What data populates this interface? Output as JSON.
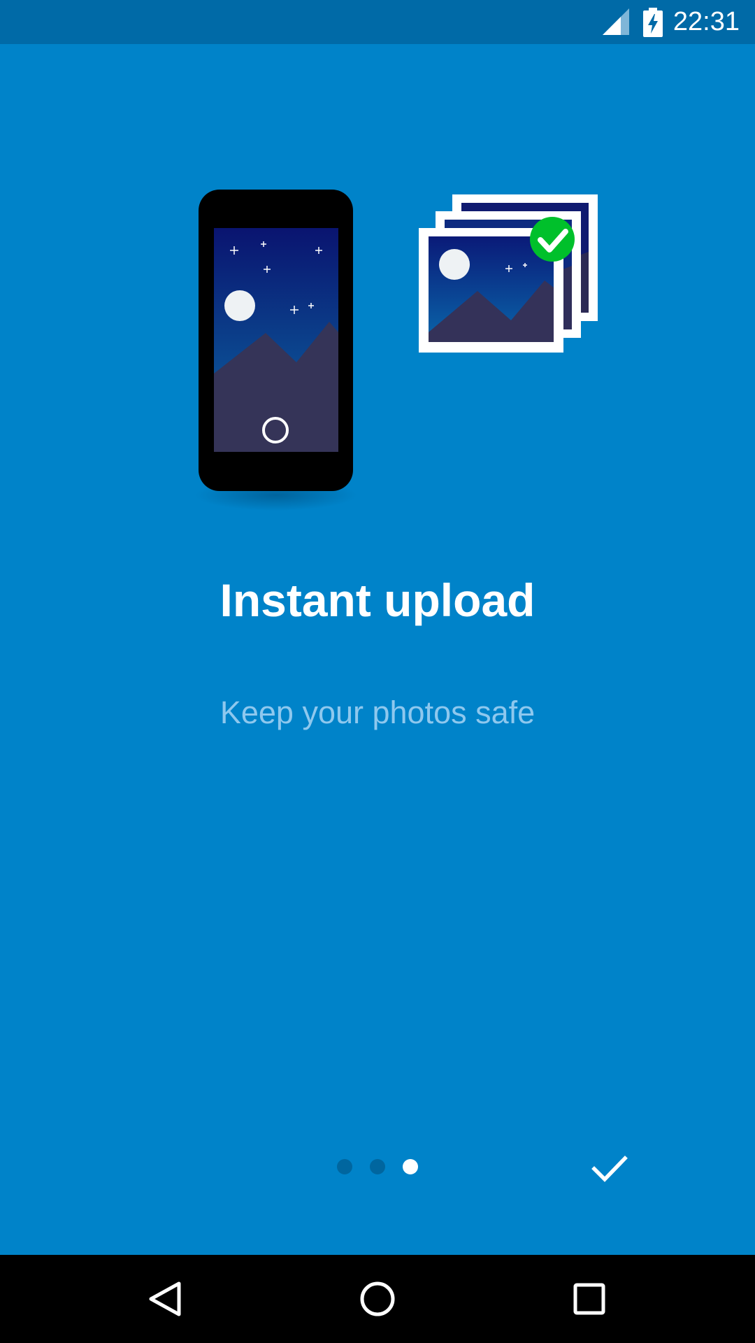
{
  "status_bar": {
    "time": "22:31",
    "icons": [
      "signal-icon",
      "battery-charging-icon"
    ]
  },
  "onboarding": {
    "title": "Instant upload",
    "subtitle": "Keep your photos safe",
    "page_count": 3,
    "current_page": 3,
    "done_icon": "check-icon"
  },
  "nav_bar": {
    "icons": [
      "back-icon",
      "home-icon",
      "recents-icon"
    ]
  },
  "colors": {
    "background": "#0083c9",
    "status_bar": "#006aa7",
    "subtitle": "#8ec8ee",
    "check_badge": "#00c02b"
  }
}
